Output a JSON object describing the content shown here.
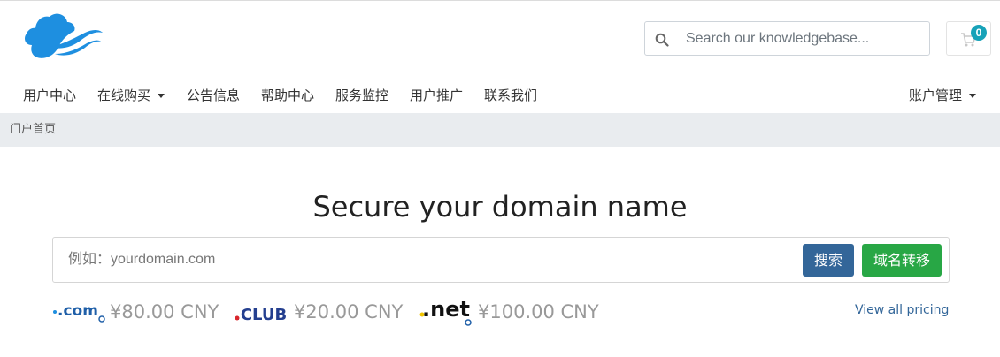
{
  "header": {
    "search_placeholder": "Search our knowledgebase...",
    "cart_count": "0",
    "accent_color": "#17a2b8",
    "logo_icon": "cloud-logo-icon"
  },
  "nav": {
    "items": [
      {
        "label": "用户中心"
      },
      {
        "label": "在线购买",
        "dropdown": true
      },
      {
        "label": "公告信息"
      },
      {
        "label": "帮助中心"
      },
      {
        "label": "服务监控"
      },
      {
        "label": "用户推广"
      },
      {
        "label": "联系我们"
      }
    ],
    "account_label": "账户管理"
  },
  "breadcrumb": {
    "current": "门户首页"
  },
  "domain": {
    "title": "Secure your domain name",
    "input_placeholder": "例如：yourdomain.com",
    "search_button": "搜索",
    "transfer_button": "域名转移",
    "search_button_color": "#336699",
    "transfer_button_color": "#28a745",
    "tlds": [
      {
        "name": ".com",
        "price": "¥80.00 CNY"
      },
      {
        "name": ".CLUB",
        "price": "¥20.00 CNY"
      },
      {
        "name": ".net",
        "price": "¥100.00 CNY"
      }
    ],
    "view_all_label": "View all pricing"
  }
}
